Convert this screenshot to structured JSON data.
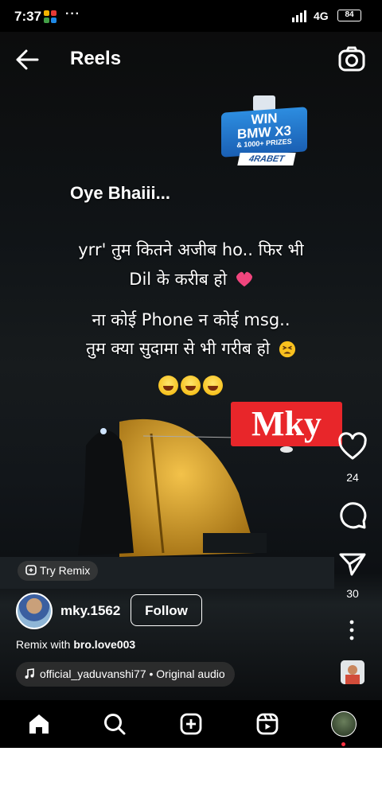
{
  "status_bar": {
    "time": "7:37",
    "dots": "···",
    "network": "4G",
    "battery": "84"
  },
  "header": {
    "title": "Reels"
  },
  "ad": {
    "line1": "WIN",
    "line2": "BMW X3",
    "line3": "& 1000+ PRIZES",
    "brand": "4RABET"
  },
  "caption": {
    "heading": "Oye Bhaiii...",
    "line1": "yrr' तुम कितने अजीब ho.. फिर भी",
    "line2": "Dil के करीब हो",
    "line3": "ना कोई Phone न कोई msg..",
    "line4": "तुम क्या सुदामा से भी गरीब हो"
  },
  "watermark": "Mky",
  "actions": {
    "likes": "24",
    "shares": "30"
  },
  "try_remix": "Try Remix",
  "author": {
    "username": "mky.1562",
    "follow_label": "Follow"
  },
  "remix": {
    "prefix": "Remix with ",
    "user": "bro.love003"
  },
  "audio": {
    "text": "official_yaduvanshi77 • Original audio"
  },
  "icons": [
    "back-arrow-icon",
    "camera-icon",
    "heart-icon",
    "comment-icon",
    "share-icon",
    "more-icon",
    "music-note-icon",
    "home-icon",
    "search-icon",
    "create-icon",
    "reels-icon",
    "remix-icon"
  ]
}
